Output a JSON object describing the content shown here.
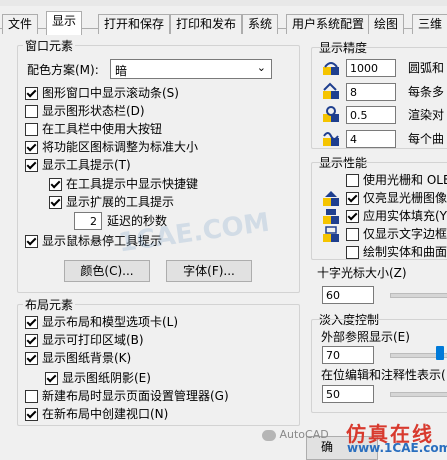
{
  "tabs": [
    "文件",
    "显示",
    "打开和保存",
    "打印和发布",
    "系统",
    "用户系统配置",
    "绘图",
    "三维"
  ],
  "window_section": {
    "title": "窗口元素",
    "color_scheme_label": "配色方案(M):",
    "color_scheme_value": "暗",
    "options": [
      {
        "label": "图形窗口中显示滚动条(S)",
        "checked": true
      },
      {
        "label": "显示图形状态栏(D)",
        "checked": false
      },
      {
        "label": "在工具栏中使用大按钮",
        "checked": false
      },
      {
        "label": "将功能区图标调整为标准大小",
        "checked": true
      },
      {
        "label": "显示工具提示(T)",
        "checked": true
      },
      {
        "label": "在工具提示中显示快捷键",
        "checked": true
      },
      {
        "label": "显示扩展的工具提示",
        "checked": true
      }
    ],
    "delay_value": "2",
    "delay_label": "延迟的秒数",
    "hover_tooltip": {
      "label": "显示鼠标悬停工具提示",
      "checked": true
    },
    "colors_button": "颜色(C)...",
    "fonts_button": "字体(F)..."
  },
  "layout_section": {
    "title": "布局元素",
    "options": [
      {
        "label": "显示布局和模型选项卡(L)",
        "checked": true
      },
      {
        "label": "显示可打印区域(B)",
        "checked": true
      },
      {
        "label": "显示图纸背景(K)",
        "checked": true
      },
      {
        "label": "显示图纸阴影(E)",
        "checked": true
      },
      {
        "label": "新建布局时显示页面设置管理器(G)",
        "checked": false
      },
      {
        "label": "在新布局中创建视口(N)",
        "checked": true
      }
    ]
  },
  "precision_section": {
    "title": "显示精度",
    "items": [
      {
        "value": "1000",
        "label": "圆弧和"
      },
      {
        "value": "8",
        "label": "每条多"
      },
      {
        "value": "0.5",
        "label": "渲染对"
      },
      {
        "value": "4",
        "label": "每个曲"
      }
    ]
  },
  "performance_section": {
    "title": "显示性能",
    "items": [
      {
        "label": "使用光栅和 OLE",
        "checked": false,
        "icon": false
      },
      {
        "label": "仅亮显光栅图像",
        "checked": true,
        "icon": true
      },
      {
        "label": "应用实体填充(Y)",
        "checked": true,
        "icon": true
      },
      {
        "label": "仅显示文字边框",
        "checked": false,
        "icon": true
      },
      {
        "label": "绘制实体和曲面",
        "checked": false,
        "icon": false
      }
    ]
  },
  "crosshair_section": {
    "title": "十字光标大小(Z)",
    "value": "60",
    "fraction": 0.6
  },
  "fade_section": {
    "title": "淡入度控制",
    "xref_label": "外部参照显示(E)",
    "xref_value": "70",
    "xref_fraction": 0.7,
    "inplace_label": "在位编辑和注释性表示(",
    "inplace_value": "50",
    "inplace_fraction": 0.5
  },
  "bottom": {
    "ok_button_partial": "确"
  },
  "watermarks": {
    "center": "1CAE.COM",
    "wechat": "AutoCAD",
    "site_cn": "仿真在线",
    "site_url": "www.1CAE.com"
  },
  "colors": {
    "icon_yellow": "#f5c400",
    "icon_navy": "#1f3f8f",
    "watermark_red": "#d83a2e",
    "watermark_blue": "#2a6fbf"
  }
}
